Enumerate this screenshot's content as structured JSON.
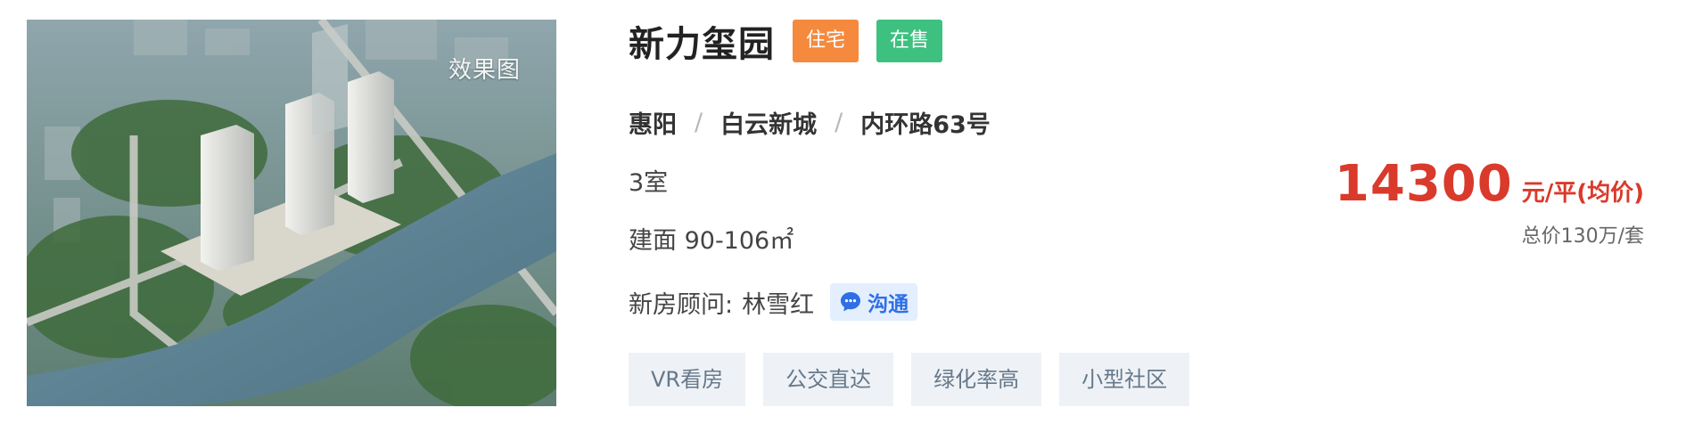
{
  "listing": {
    "image_label": "效果图",
    "title": "新力玺园",
    "tags": {
      "type": "住宅",
      "status": "在售"
    },
    "location": {
      "district": "惠阳",
      "area": "白云新城",
      "address": "内环路63号",
      "separator": "/"
    },
    "rooms": "3室",
    "floor_area": "建面 90-106㎡",
    "agent": {
      "label": "新房顾问:",
      "name": "林雪红",
      "chat_label": "沟通",
      "chat_icon": "chat-bubble-icon"
    },
    "features": [
      "VR看房",
      "公交直达",
      "绿化率高",
      "小型社区"
    ],
    "price": {
      "value": "14300",
      "unit": "元/平(均价)",
      "total": "总价130万/套"
    }
  },
  "colors": {
    "tag_type": "#f58a3e",
    "tag_status": "#3ec180",
    "price": "#d93a2b",
    "chat_accent": "#2f6fe6"
  }
}
